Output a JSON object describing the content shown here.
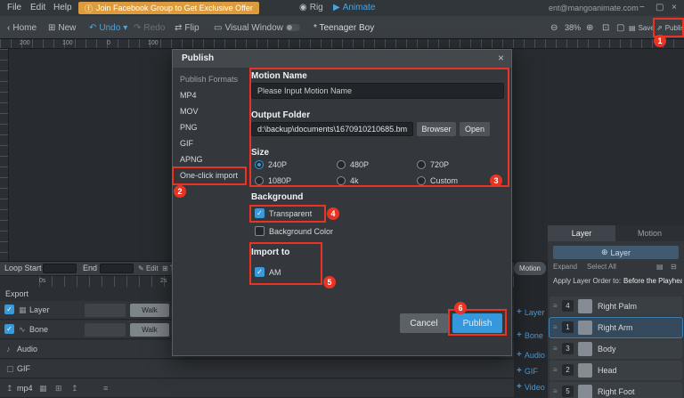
{
  "menubar": {
    "menus": [
      "File",
      "Edit",
      "Help"
    ],
    "banner": "Join Facebook Group to Get Exclusive Offer",
    "rig": "Rig",
    "animate": "Animate",
    "account": "ent@mangoanimate.com"
  },
  "toolbar": {
    "home": "Home",
    "new": "New",
    "undo": "Undo",
    "redo": "Redo",
    "flip": "Flip",
    "visual_window": "Visual Window",
    "title": "* Teenager Boy",
    "zoom": "38%",
    "save": "Save",
    "publish": "Publish"
  },
  "ruler": {
    "h_ticks": [
      "200",
      "100",
      "0",
      "100"
    ]
  },
  "modal": {
    "title": "Publish",
    "close": "×",
    "formats_label": "Publish Formats",
    "formats": [
      "MP4",
      "MOV",
      "PNG",
      "GIF",
      "APNG",
      "One-click import"
    ],
    "motion_name_label": "Motion Name",
    "motion_name_placeholder": "Please Input Motion Name",
    "output_folder_label": "Output Folder",
    "output_folder_value": "d:\\backup\\documents\\1670910210685.bms",
    "browser_button": "Browser",
    "open_button": "Open",
    "size_label": "Size",
    "sizes": [
      "240P",
      "480P",
      "720P",
      "1080P",
      "4k",
      "Custom"
    ],
    "selected_size": "240P",
    "background_label": "Background",
    "transparent_label": "Transparent",
    "background_color_label": "Background Color",
    "import_to_label": "Import to",
    "am_label": "AM",
    "cancel_button": "Cancel",
    "publish_button": "Publish"
  },
  "timeline": {
    "loop_start_label": "Loop Start",
    "end_label": "End",
    "edit_label": "Edit",
    "track_label": "Track",
    "ticks": [
      "0s",
      "2s"
    ],
    "export_label": "Export",
    "tracks": [
      "Layer",
      "Bone",
      "Audio",
      "GIF",
      "mp4"
    ],
    "clip_name": "Walk"
  },
  "rightpanel": {
    "tabs": [
      "Layer",
      "Motion"
    ],
    "add_layer": "Layer",
    "expand": "Expand",
    "select_all": "Select All",
    "apply_label": "Apply Layer Order to:",
    "apply_value": "Before the Playhead",
    "layers": [
      {
        "num": "4",
        "name": "Right Palm"
      },
      {
        "num": "1",
        "name": "Right Arm"
      },
      {
        "num": "3",
        "name": "Body"
      },
      {
        "num": "2",
        "name": "Head"
      },
      {
        "num": "5",
        "name": "Right Foot"
      }
    ]
  },
  "sidebar_add": {
    "motion": "Motion",
    "items": [
      "Layer",
      "Bone",
      "Audio",
      "GIF",
      "Video"
    ]
  },
  "annotations": [
    "1",
    "2",
    "3",
    "4",
    "5",
    "6"
  ]
}
